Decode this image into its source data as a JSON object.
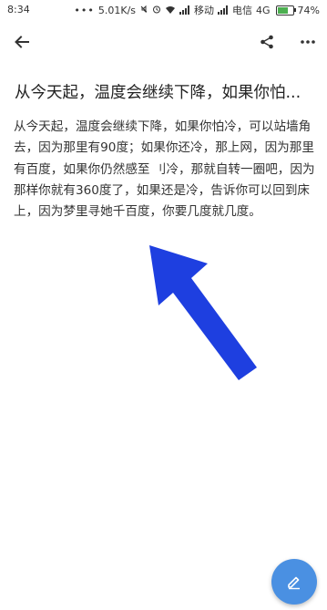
{
  "status_bar": {
    "time": "8:34",
    "dots": "•••",
    "net_speed": "5.01K/s",
    "carrier1": "移动",
    "carrier2": "电信",
    "network": "4G",
    "battery": "74%",
    "battery_level": 0.74,
    "battery_color": "#4caf50"
  },
  "toolbar": {
    "back_icon": "arrow-back-icon",
    "share_icon": "share-icon",
    "more_icon": "more-horizontal-icon"
  },
  "note": {
    "title": "从今天起，温度会继续下降，如果你怕...",
    "body": "从今天起，温度会继续下降，如果你怕冷，可以站墙角去，因为那里有90度；如果你还冷，那上网，因为那里有百度，如果你仍然感至 刂冷，那就自转一圈吧，因为那样你就有360度了，如果还是冷，告诉你可以回到床上，因为梦里寻她千百度，你要几度就几度。"
  },
  "annotation": {
    "arrow_color": "#1e3fe0"
  },
  "fab": {
    "icon": "edit-icon",
    "color": "#4a90e2"
  }
}
